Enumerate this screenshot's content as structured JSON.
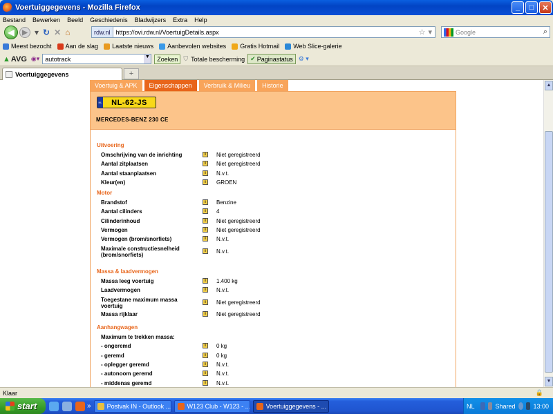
{
  "window": {
    "title": "Voertuiggegevens - Mozilla Firefox"
  },
  "menu": [
    "Bestand",
    "Bewerken",
    "Beeld",
    "Geschiedenis",
    "Bladwijzers",
    "Extra",
    "Help"
  ],
  "address": {
    "site": "rdw.nl",
    "url": "https://ovi.rdw.nl/VoertuigDetails.aspx"
  },
  "search": {
    "placeholder": "Google"
  },
  "bookmarks": [
    {
      "label": "Meest bezocht",
      "color": "#3a7ad8"
    },
    {
      "label": "Aan de slag",
      "color": "#d83a1a"
    },
    {
      "label": "Laatste nieuws",
      "color": "#e89a20"
    },
    {
      "label": "Aanbevolen websites",
      "color": "#3a9ae8"
    },
    {
      "label": "Gratis Hotmail",
      "color": "#f0a818"
    },
    {
      "label": "Web Slice-galerie",
      "color": "#2a88d8"
    }
  ],
  "avg": {
    "logo": "AVG",
    "search_value": "autotrack",
    "search_button": "Zoeken",
    "protection": "Totale bescherming",
    "page_status": "Paginastatus"
  },
  "browser_tab": {
    "label": "Voertuiggegevens",
    "new_tab": "+"
  },
  "page": {
    "tabs": [
      "Voertuig & APK",
      "Eigenschappen",
      "Verbruik & Milieu",
      "Historie"
    ],
    "plate": "NL-62-JS",
    "plate_eu": "NL",
    "model": "MERCEDES-BENZ  230 CE",
    "info_glyph": "i",
    "sections": [
      {
        "title": "Uitvoering",
        "rows": [
          {
            "label": "Omschrijving van de inrichting",
            "value": "Niet geregistreerd"
          },
          {
            "label": "Aantal zitplaatsen",
            "value": "Niet geregistreerd"
          },
          {
            "label": "Aantal staanplaatsen",
            "value": "N.v.t."
          },
          {
            "label": "Kleur(en)",
            "value": "GROEN"
          }
        ]
      },
      {
        "title": "Motor",
        "rows": [
          {
            "label": "Brandstof",
            "value": "Benzine"
          },
          {
            "label": "Aantal cilinders",
            "value": "4"
          },
          {
            "label": "Cilinderinhoud",
            "value": "Niet geregistreerd"
          },
          {
            "label": "Vermogen",
            "value": "Niet geregistreerd"
          },
          {
            "label": "Vermogen (brom/snorfiets)",
            "value": "N.v.t."
          },
          {
            "label": "Maximale constructiesnelheid (brom/snorfiets)",
            "value": "N.v.t."
          }
        ]
      },
      {
        "title": "Massa & laadvermogen",
        "rows": [
          {
            "label": "Massa leeg voertuig",
            "value": "1.400 kg"
          },
          {
            "label": "Laadvermogen",
            "value": "N.v.t."
          },
          {
            "label": "Toegestane maximum massa voertuig",
            "value": "Niet geregistreerd"
          },
          {
            "label": "Massa rijklaar",
            "value": "Niet geregistreerd"
          }
        ]
      },
      {
        "title": "Aanhangwagen",
        "subtitle": "Maximum te trekken massa:",
        "rows": [
          {
            "label": "- ongeremd",
            "value": "0 kg"
          },
          {
            "label": "- geremd",
            "value": "0 kg"
          },
          {
            "label": "- oplegger geremd",
            "value": "N.v.t."
          },
          {
            "label": "- autonoom geremd",
            "value": "N.v.t."
          },
          {
            "label": "- middenas geremd",
            "value": "N.v.t."
          }
        ]
      }
    ]
  },
  "statusbar": {
    "text": "Klaar"
  },
  "taskbar": {
    "start": "start",
    "tasks": [
      {
        "label": "Postvak IN - Outlook ...",
        "color": "#e8c040"
      },
      {
        "label": "W123 Club - W123 - ...",
        "color": "#e8651a"
      },
      {
        "label": "Voertuiggegevens - ...",
        "color": "#e8651a"
      }
    ],
    "more": "»",
    "lang": "NL",
    "shared": "Shared",
    "clock": "13:00"
  }
}
